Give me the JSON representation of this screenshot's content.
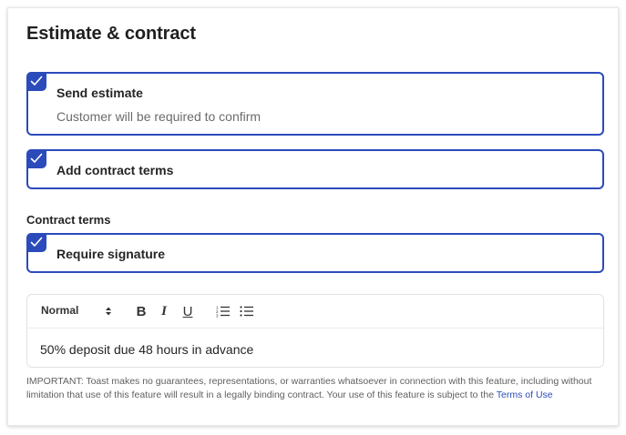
{
  "header": {
    "title": "Estimate & contract"
  },
  "options": {
    "send_estimate": {
      "label": "Send estimate",
      "description": "Customer will be required to confirm",
      "checked": true
    },
    "add_contract_terms": {
      "label": "Add contract terms",
      "checked": true
    }
  },
  "contract_terms": {
    "section_label": "Contract terms",
    "require_signature": {
      "label": "Require signature",
      "checked": true
    },
    "editor": {
      "format_value": "Normal",
      "content": "50% deposit due 48 hours in advance",
      "toolbar": {
        "bold_label": "B",
        "italic_label": "I",
        "underline_label": "U"
      }
    }
  },
  "disclaimer": {
    "text": "IMPORTANT: Toast makes no guarantees, representations, or warranties whatsoever in connection with this feature, including without limitation that use of this feature will result in a legally binding contract. Your use of this feature is subject to the ",
    "link_text": "Terms of Use"
  },
  "colors": {
    "accent": "#2b4bba",
    "text": "#252525",
    "muted": "#6b6b6b"
  },
  "icons": {
    "checkbox": "checkmark-icon",
    "format_arrows": "updown-arrows-icon",
    "ordered_list": "ordered-list-icon",
    "bullet_list": "bullet-list-icon"
  }
}
